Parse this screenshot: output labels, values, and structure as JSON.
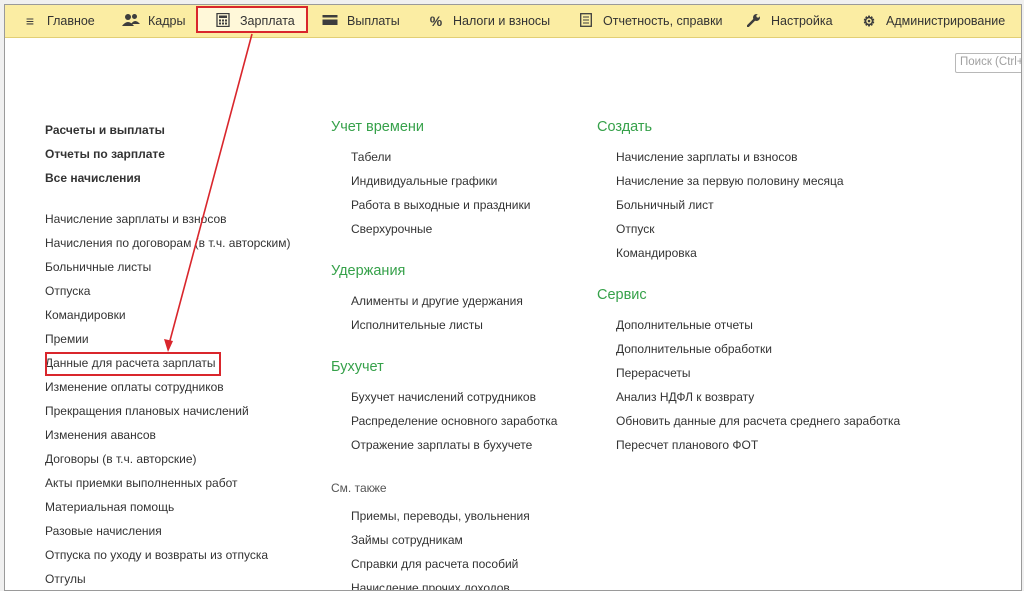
{
  "nav": {
    "items": [
      {
        "label": "Главное",
        "icon": "hamburger-icon"
      },
      {
        "label": "Кадры",
        "icon": "people-icon"
      },
      {
        "label": "Зарплата",
        "icon": "calculator-icon"
      },
      {
        "label": "Выплаты",
        "icon": "card-icon"
      },
      {
        "label": "Налоги и взносы",
        "icon": "percent-icon"
      },
      {
        "label": "Отчетность, справки",
        "icon": "document-icon"
      },
      {
        "label": "Настройка",
        "icon": "wrench-icon"
      },
      {
        "label": "Администрирование",
        "icon": "gear-icon"
      }
    ],
    "active": "Зарплата"
  },
  "search": {
    "placeholder": "Поиск (Ctrl+F)"
  },
  "left": {
    "bold": [
      "Расчеты и выплаты",
      "Отчеты по зарплате",
      "Все начисления"
    ],
    "links": [
      "Начисление зарплаты и взносов",
      "Начисления по договорам (в т.ч. авторским)",
      "Больничные листы",
      "Отпуска",
      "Командировки",
      "Премии",
      "Данные для расчета зарплаты",
      "Изменение оплаты сотрудников",
      "Прекращения плановых начислений",
      "Изменения авансов",
      "Договоры (в т.ч. авторские)",
      "Акты приемки выполненных работ",
      "Материальная помощь",
      "Разовые начисления",
      "Отпуска по уходу и возвраты из отпуска",
      "Отгулы"
    ]
  },
  "middle": {
    "time": {
      "title": "Учет времени",
      "items": [
        "Табели",
        "Индивидуальные графики",
        "Работа в выходные и праздники",
        "Сверхурочные"
      ]
    },
    "deductions": {
      "title": "Удержания",
      "items": [
        "Алименты и другие удержания",
        "Исполнительные листы"
      ]
    },
    "accounting": {
      "title": "Бухучет",
      "items": [
        "Бухучет начислений сотрудников",
        "Распределение основного заработка",
        "Отражение зарплаты в бухучете"
      ]
    },
    "see_also": {
      "title": "См. также",
      "items": [
        "Приемы, переводы, увольнения",
        "Займы сотрудникам",
        "Справки для расчета пособий",
        "Начисление прочих доходов"
      ]
    }
  },
  "right": {
    "create": {
      "title": "Создать",
      "items": [
        "Начисление зарплаты и взносов",
        "Начисление за первую половину месяца",
        "Больничный лист",
        "Отпуск",
        "Командировка"
      ]
    },
    "service": {
      "title": "Сервис",
      "items": [
        "Дополнительные отчеты",
        "Дополнительные обработки",
        "Перерасчеты",
        "Анализ НДФЛ к возврату",
        "Обновить данные для расчета среднего заработка",
        "Пересчет планового ФОТ"
      ]
    }
  }
}
